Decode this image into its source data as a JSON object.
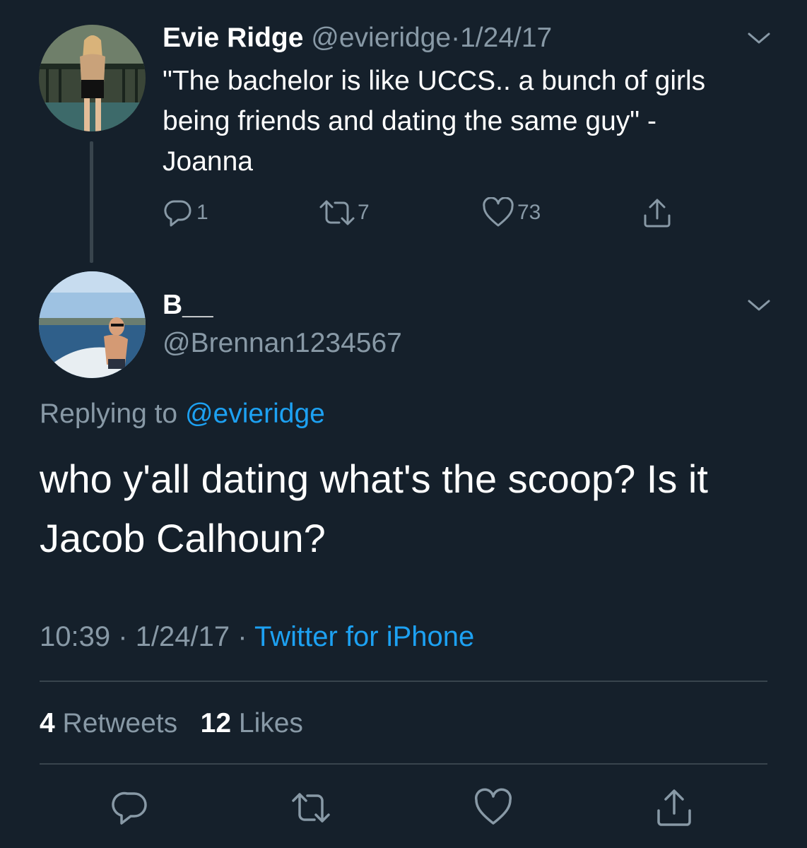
{
  "colors": {
    "background": "#15202b",
    "text_primary": "#ffffff",
    "text_muted": "#8899a6",
    "link": "#1da1f2",
    "divider": "#38444d"
  },
  "parent_tweet": {
    "display_name": "Evie Ridge",
    "handle": "@evieridge",
    "separator": "·",
    "date": "1/24/17",
    "text": "\"The bachelor is like UCCS.. a bunch of girls being friends and dating the same guy\" -Joanna",
    "actions": {
      "reply_icon": "reply-icon",
      "reply_count": "1",
      "retweet_icon": "retweet-icon",
      "retweet_count": "7",
      "like_icon": "heart-icon",
      "like_count": "73",
      "share_icon": "share-icon"
    },
    "menu_icon": "chevron-down-icon"
  },
  "reply_tweet": {
    "display_name": "B__",
    "handle": "@Brennan1234567",
    "menu_icon": "chevron-down-icon",
    "replying_prefix": "Replying to",
    "replying_to": "@evieridge",
    "text": "who y'all dating what's the scoop? Is it Jacob Calhoun?",
    "time": "10:39",
    "separator": "·",
    "date": "1/24/17",
    "source": "Twitter for iPhone",
    "stats": {
      "retweets_count": "4",
      "retweets_label": "Retweets",
      "likes_count": "12",
      "likes_label": "Likes"
    },
    "bottom_actions": [
      "reply-icon",
      "retweet-icon",
      "heart-icon",
      "share-icon"
    ]
  }
}
